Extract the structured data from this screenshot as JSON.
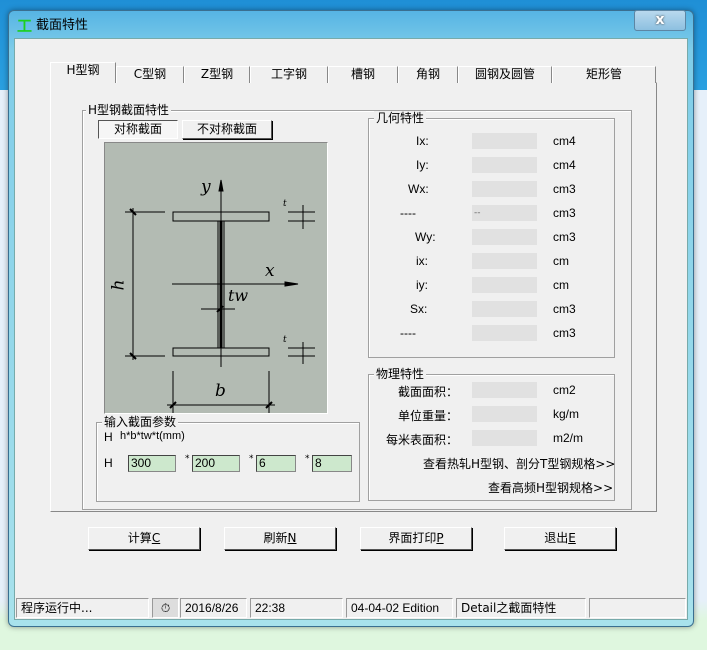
{
  "window": {
    "title": "截面特性",
    "icon": "i-beam-icon",
    "close": "x"
  },
  "tabs": [
    "H型钢",
    "C型钢",
    "Z型钢",
    "工字钢",
    "槽钢",
    "角钢",
    "圆钢及圆管",
    "矩形管"
  ],
  "section_group": {
    "title": "H型钢截面特性",
    "sym_button": "对称截面",
    "asym_button": "不对称截面"
  },
  "diagram": {
    "y": "y",
    "x": "x",
    "h": "h",
    "b": "b",
    "tw": "tw",
    "t": "t"
  },
  "input_group": {
    "title": "输入截面参数",
    "format_prefix": "H",
    "format": "h*b*tw*t(mm)",
    "row_prefix": "H",
    "sep": "*",
    "values": [
      "300",
      "200",
      "6",
      "8"
    ]
  },
  "geometry": {
    "title": "几何特性",
    "rows": [
      {
        "label": "Ix:",
        "value": "",
        "unit": "cm4"
      },
      {
        "label": "Iy:",
        "value": "",
        "unit": "cm4"
      },
      {
        "label": "Wx:",
        "value": "",
        "unit": "cm3"
      },
      {
        "label": "----",
        "value": "--",
        "unit": "cm3"
      },
      {
        "label": "Wy:",
        "value": "",
        "unit": "cm3"
      },
      {
        "label": "ix:",
        "value": "",
        "unit": "cm"
      },
      {
        "label": "iy:",
        "value": "",
        "unit": "cm"
      },
      {
        "label": "Sx:",
        "value": "",
        "unit": "cm3"
      },
      {
        "label": "----",
        "value": "",
        "unit": "cm3"
      }
    ]
  },
  "physical": {
    "title": "物理特性",
    "rows": [
      {
        "label": "截面面积：",
        "value": "",
        "unit": "cm2"
      },
      {
        "label": "单位重量：",
        "value": "",
        "unit": "kg/m"
      },
      {
        "label": "每米表面积：",
        "value": "",
        "unit": "m2/m"
      }
    ],
    "link1": "查看热轧H型钢、剖分T型钢规格>>",
    "link2": "查看高频H型钢规格>>"
  },
  "buttons": [
    {
      "label": "计算",
      "key": "C"
    },
    {
      "label": "刷新",
      "key": "N"
    },
    {
      "label": "界面打印",
      "key": "P"
    },
    {
      "label": "退出",
      "key": "E"
    }
  ],
  "status": {
    "state": "程序运行中...",
    "date": "2016/8/26",
    "time": "22:38",
    "edition": "04-04-02 Edition",
    "module": "Detail之截面特性"
  }
}
